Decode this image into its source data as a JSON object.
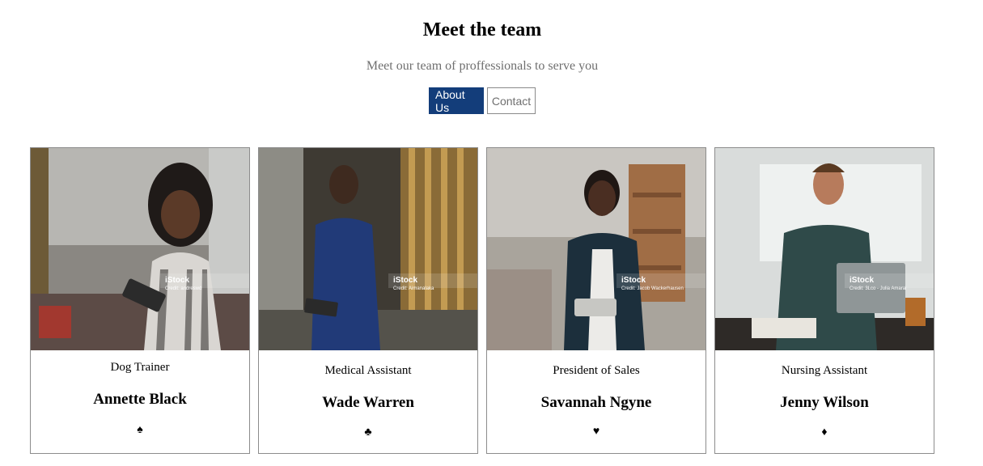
{
  "header": {
    "title": "Meet the team",
    "subtitle": "Meet our team of proffessionals to serve you"
  },
  "buttons": {
    "about": "About Us",
    "contact": "Contact"
  },
  "colors": {
    "primary": "#133d7a"
  },
  "team": [
    {
      "role": "Dog Trainer",
      "name": "Annette Black",
      "suit": "♠",
      "suit_icon": "spade-icon",
      "watermark": {
        "brand": "iStock",
        "credit": "Credit: andreswd"
      }
    },
    {
      "role": "Medical Assistant",
      "name": "Wade Warren",
      "suit": "♣",
      "suit_icon": "club-icon",
      "watermark": {
        "brand": "iStock",
        "credit": "Credit: Aimanalaka"
      }
    },
    {
      "role": "President of Sales",
      "name": "Savannah Ngyne",
      "suit": "♥",
      "suit_icon": "heart-icon",
      "watermark": {
        "brand": "iStock",
        "credit": "Credit: Jacob Wackerhausen"
      }
    },
    {
      "role": "Nursing Assistant",
      "name": "Jenny Wilson",
      "suit": "♦",
      "suit_icon": "diamond-icon",
      "watermark": {
        "brand": "iStock",
        "credit": "Credit: 3Lco - Julia Amaral"
      }
    }
  ]
}
